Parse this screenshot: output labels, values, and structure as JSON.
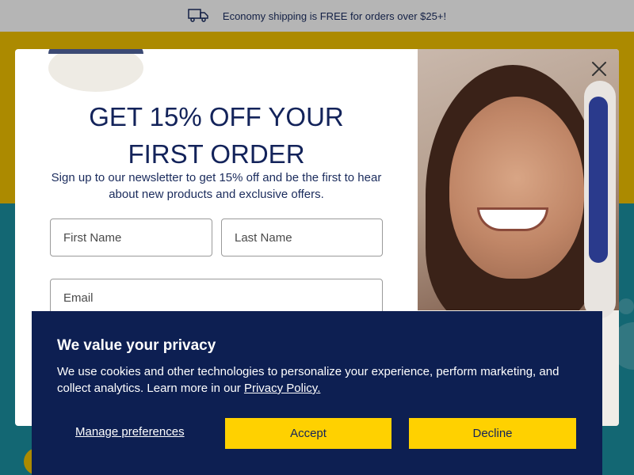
{
  "announcement": {
    "icon": "truck-icon",
    "text": "Economy shipping is FREE for orders over $25+!"
  },
  "popup": {
    "headline_line1": "GET 15% OFF YOUR",
    "headline_line2": "FIRST ORDER",
    "subtext": "Sign up to our newsletter to get 15% off and be the first to hear about new products and exclusive offers.",
    "first_name_placeholder": "First Name",
    "last_name_placeholder": "Last Name",
    "email_placeholder": "Email",
    "close_icon": "close-icon"
  },
  "cookie_banner": {
    "title": "We value your privacy",
    "text": "We use cookies and other technologies to personalize your experience, perform marketing, and collect analytics. Learn more in our ",
    "link": "Privacy Policy.",
    "manage_label": "Manage preferences",
    "accept_label": "Accept",
    "decline_label": "Decline"
  },
  "colors": {
    "navy": "#0d1f52",
    "yellow": "#ffd100",
    "header_yellow": "#e6b800",
    "teal": "#1a8a9a"
  }
}
